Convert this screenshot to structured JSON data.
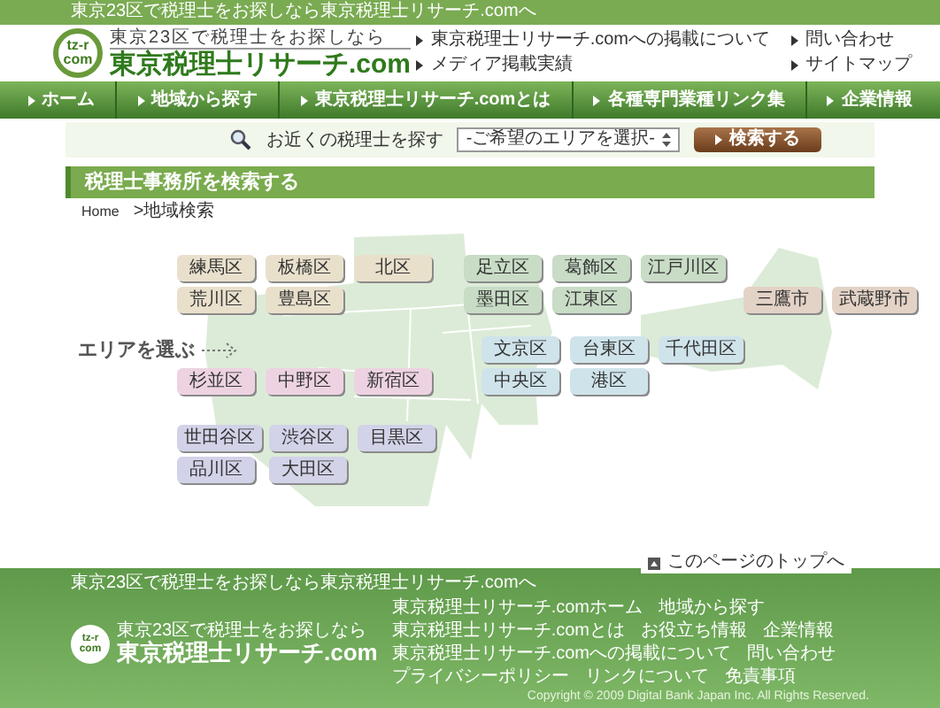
{
  "top_bar": {
    "text": "東京23区で税理士をお探しなら東京税理士リサーチ.comへ"
  },
  "header": {
    "logo_mark": [
      "tz-r",
      "com"
    ],
    "tagline": "東京23区で税理士をお探しなら",
    "site_title": "東京税理士リサーチ.com",
    "links": [
      "東京税理士リサーチ.comへの掲載について",
      "問い合わせ",
      "メディア掲載実績",
      "サイトマップ"
    ]
  },
  "nav": [
    "ホーム",
    "地域から探す",
    "東京税理士リサーチ.comとは",
    "各種専門業種リンク集",
    "企業情報"
  ],
  "search": {
    "label": "お近くの税理士を探す",
    "select_value": "-ご希望のエリアを選択-",
    "button": "検索する"
  },
  "section_title": "税理士事務所を検索する",
  "breadcrumb": [
    "Home",
    ">地域検索"
  ],
  "map": {
    "prompt": "エリアを選ぶ",
    "areas": [
      {
        "label": "練馬区",
        "color": "#e9e0cc"
      },
      {
        "label": "板橋区",
        "color": "#e9e0cc"
      },
      {
        "label": "北区",
        "color": "#e9e0cc"
      },
      {
        "label": "足立区",
        "color": "#c8dcc6"
      },
      {
        "label": "葛飾区",
        "color": "#c8dcc6"
      },
      {
        "label": "江戸川区",
        "color": "#c8dcc6"
      },
      {
        "label": "荒川区",
        "color": "#e9e0cc"
      },
      {
        "label": "豊島区",
        "color": "#e9e0cc"
      },
      {
        "label": "墨田区",
        "color": "#c8dcc6"
      },
      {
        "label": "江東区",
        "color": "#c8dcc6"
      },
      {
        "label": "三鷹市",
        "color": "#e3d2c6"
      },
      {
        "label": "武蔵野市",
        "color": "#e3d2c6"
      },
      {
        "label": "文京区",
        "color": "#cfe3ea"
      },
      {
        "label": "台東区",
        "color": "#cfe3ea"
      },
      {
        "label": "千代田区",
        "color": "#cfe3ea"
      },
      {
        "label": "杉並区",
        "color": "#edd3e2"
      },
      {
        "label": "中野区",
        "color": "#edd3e2"
      },
      {
        "label": "新宿区",
        "color": "#edd3e2"
      },
      {
        "label": "中央区",
        "color": "#cfe3ea"
      },
      {
        "label": "港区",
        "color": "#cfe3ea"
      },
      {
        "label": "世田谷区",
        "color": "#d2d2e8"
      },
      {
        "label": "渋谷区",
        "color": "#d2d2e8"
      },
      {
        "label": "目黒区",
        "color": "#d2d2e8"
      },
      {
        "label": "品川区",
        "color": "#d2d2e8"
      },
      {
        "label": "大田区",
        "color": "#d2d2e8"
      }
    ]
  },
  "footer": {
    "page_top": "このページのトップへ",
    "tagline": "東京23区で税理士をお探しなら東京税理士リサーチ.comへ",
    "logo_mark": [
      "tz-r",
      "com"
    ],
    "logo_tagline": "東京23区で税理士をお探しなら",
    "site_title": "東京税理士リサーチ.com",
    "links": [
      "東京税理士リサーチ.comホーム",
      "地域から探す",
      "東京税理士リサーチ.comとは",
      "お役立ち情報",
      "企業情報",
      "東京税理士リサーチ.comへの掲載について",
      "問い合わせ",
      "プライバシーポリシー",
      "リンクについて",
      "免責事項"
    ],
    "copyright": "Copyright © 2009 Digital Bank Japan Inc. All Rights Reserved."
  }
}
